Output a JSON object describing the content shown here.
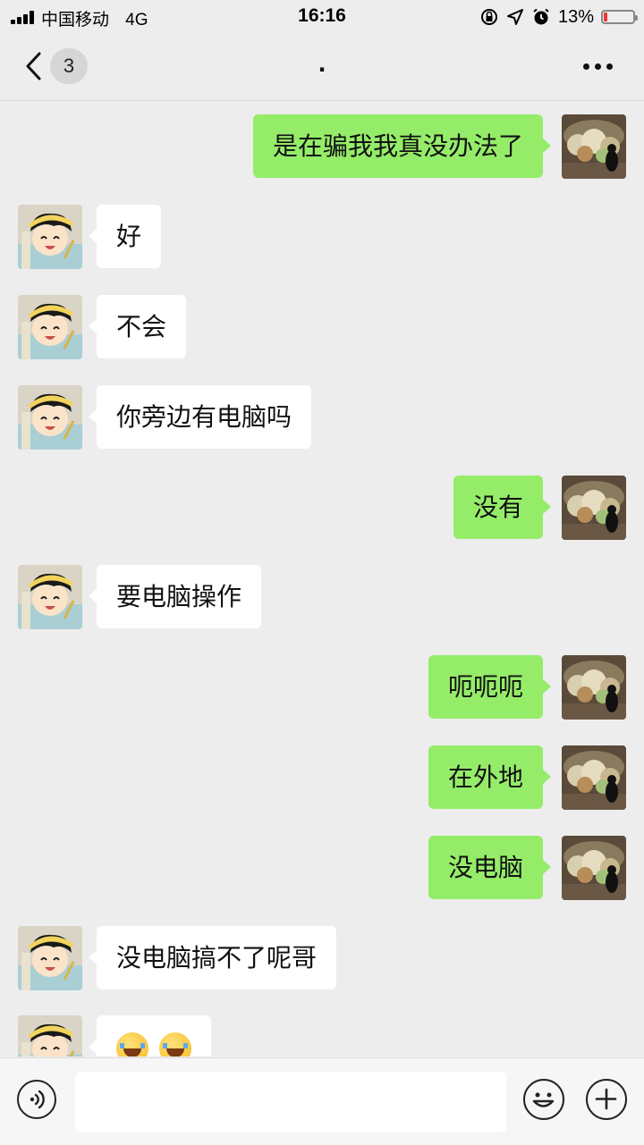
{
  "status_bar": {
    "carrier": "中国移动",
    "network": "4G",
    "time": "16:16",
    "battery_percent": "13%",
    "battery_level": 0.13,
    "icons": [
      "signal-icon",
      "lock-rotation-icon",
      "location-arrow-icon",
      "alarm-icon",
      "battery-icon"
    ]
  },
  "nav": {
    "unread_count": "3",
    "title": ".",
    "icons": [
      "back-chevron-icon",
      "more-dots-icon"
    ]
  },
  "messages": [
    {
      "side": "right",
      "text": "是在骗我我真没办法了"
    },
    {
      "side": "left",
      "text": "好"
    },
    {
      "side": "left",
      "text": "不会"
    },
    {
      "side": "left",
      "text": "你旁边有电脑吗"
    },
    {
      "side": "right",
      "text": "没有"
    },
    {
      "side": "left",
      "text": "要电脑操作"
    },
    {
      "side": "right",
      "text": "呃呃呃"
    },
    {
      "side": "right",
      "text": "在外地"
    },
    {
      "side": "right",
      "text": "没电脑"
    },
    {
      "side": "left",
      "text": "没电脑搞不了呢哥"
    },
    {
      "side": "left",
      "text": "",
      "emoji": "tears-of-joy-icon",
      "emoji_count": 2
    }
  ],
  "input_bar": {
    "text_value": "",
    "icons": [
      "voice-icon",
      "emoji-icon",
      "plus-icon"
    ]
  }
}
